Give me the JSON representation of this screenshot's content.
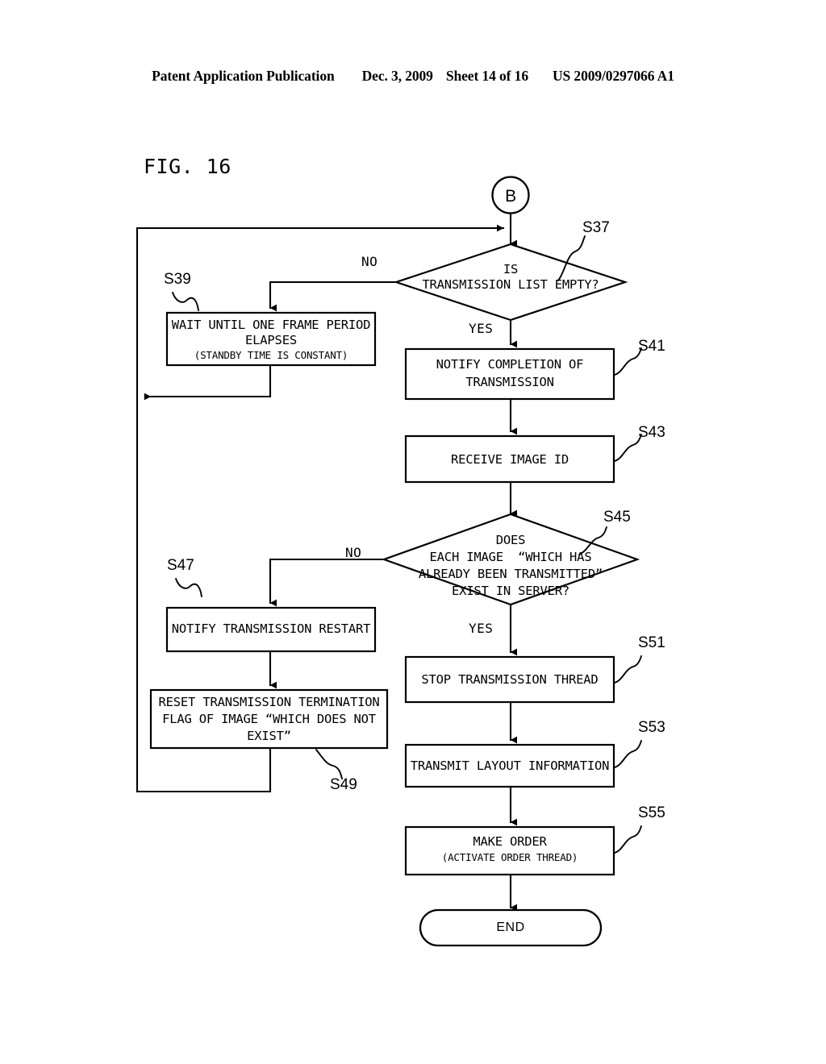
{
  "header": {
    "publication": "Patent Application Publication",
    "date": "Dec. 3, 2009",
    "sheet": "Sheet 14 of 16",
    "number": "US 2009/0297066 A1"
  },
  "figure": {
    "title": "FIG. 16"
  },
  "chart_data": {
    "type": "diagram",
    "diagram_kind": "flowchart",
    "title": "FIG. 16",
    "nodes": [
      {
        "id": "B",
        "shape": "connector",
        "label": "B"
      },
      {
        "id": "S37",
        "shape": "decision",
        "step": "S37",
        "label": "IS\nTRANSMISSION LIST EMPTY?"
      },
      {
        "id": "S39",
        "shape": "process",
        "step": "S39",
        "label": "WAIT UNTIL ONE FRAME PERIOD\nELAPSES",
        "sublabel": "(STANDBY TIME IS CONSTANT)"
      },
      {
        "id": "S41",
        "shape": "process",
        "step": "S41",
        "label": "NOTIFY COMPLETION OF\nTRANSMISSION"
      },
      {
        "id": "S43",
        "shape": "process",
        "step": "S43",
        "label": "RECEIVE IMAGE ID"
      },
      {
        "id": "S45",
        "shape": "decision",
        "step": "S45",
        "label": "DOES\nEACH IMAGE  “WHICH HAS\nALREADY BEEN TRANSMITTED”\nEXIST IN SERVER?"
      },
      {
        "id": "S47",
        "shape": "process",
        "step": "S47",
        "label": "NOTIFY TRANSMISSION RESTART"
      },
      {
        "id": "S49",
        "shape": "process",
        "step": "S49",
        "label": "RESET TRANSMISSION TERMINATION\nFLAG OF IMAGE “WHICH DOES NOT\nEXIST”"
      },
      {
        "id": "S51",
        "shape": "process",
        "step": "S51",
        "label": "STOP TRANSMISSION THREAD"
      },
      {
        "id": "S53",
        "shape": "process",
        "step": "S53",
        "label": "TRANSMIT LAYOUT INFORMATION"
      },
      {
        "id": "S55",
        "shape": "process",
        "step": "S55",
        "label": "MAKE ORDER",
        "sublabel": "(ACTIVATE ORDER THREAD)"
      },
      {
        "id": "END",
        "shape": "terminator",
        "label": "END"
      }
    ],
    "edges": [
      {
        "from": "B",
        "to": "S37",
        "label": ""
      },
      {
        "from": "S37",
        "to": "S39",
        "label": "NO"
      },
      {
        "from": "S37",
        "to": "S41",
        "label": "YES"
      },
      {
        "from": "S39",
        "to": "S37",
        "label": ""
      },
      {
        "from": "S41",
        "to": "S43",
        "label": ""
      },
      {
        "from": "S43",
        "to": "S45",
        "label": ""
      },
      {
        "from": "S45",
        "to": "S47",
        "label": "NO"
      },
      {
        "from": "S45",
        "to": "S51",
        "label": "YES"
      },
      {
        "from": "S47",
        "to": "S49",
        "label": ""
      },
      {
        "from": "S49",
        "to": "S37",
        "label": ""
      },
      {
        "from": "S51",
        "to": "S53",
        "label": ""
      },
      {
        "from": "S53",
        "to": "S55",
        "label": ""
      },
      {
        "from": "S55",
        "to": "END",
        "label": ""
      }
    ],
    "branch_labels": [
      "NO",
      "YES",
      "NO",
      "YES"
    ],
    "step_numbers": [
      "S37",
      "S39",
      "S41",
      "S43",
      "S45",
      "S47",
      "S49",
      "S51",
      "S53",
      "S55"
    ],
    "line_color": "#000000",
    "background_color": "#ffffff"
  },
  "nodes": {
    "connector_b": {
      "label": "B"
    },
    "s37": {
      "step": "S37",
      "line1": "IS",
      "line2": "TRANSMISSION LIST EMPTY?"
    },
    "s39": {
      "step": "S39",
      "line1": "WAIT UNTIL ONE FRAME PERIOD",
      "line2": "ELAPSES",
      "sub": "(STANDBY TIME IS CONSTANT)"
    },
    "s41": {
      "step": "S41",
      "line1": "NOTIFY COMPLETION OF",
      "line2": "TRANSMISSION"
    },
    "s43": {
      "step": "S43",
      "line1": "RECEIVE IMAGE ID"
    },
    "s45": {
      "step": "S45",
      "line1": "DOES",
      "line2": "EACH IMAGE  “WHICH HAS",
      "line3": "ALREADY BEEN TRANSMITTED”",
      "line4": "EXIST IN SERVER?"
    },
    "s47": {
      "step": "S47",
      "line1": "NOTIFY TRANSMISSION RESTART"
    },
    "s49": {
      "step": "S49",
      "line1": "RESET TRANSMISSION TERMINATION",
      "line2": "FLAG OF IMAGE “WHICH DOES NOT",
      "line3": "EXIST”"
    },
    "s51": {
      "step": "S51",
      "line1": "STOP TRANSMISSION THREAD"
    },
    "s53": {
      "step": "S53",
      "line1": "TRANSMIT LAYOUT INFORMATION"
    },
    "s55": {
      "step": "S55",
      "line1": "MAKE ORDER",
      "sub": "(ACTIVATE ORDER THREAD)"
    },
    "end": {
      "label": "END"
    }
  },
  "branches": {
    "no_top": "NO",
    "yes_top": "YES",
    "no_mid": "NO",
    "yes_mid": "YES"
  }
}
